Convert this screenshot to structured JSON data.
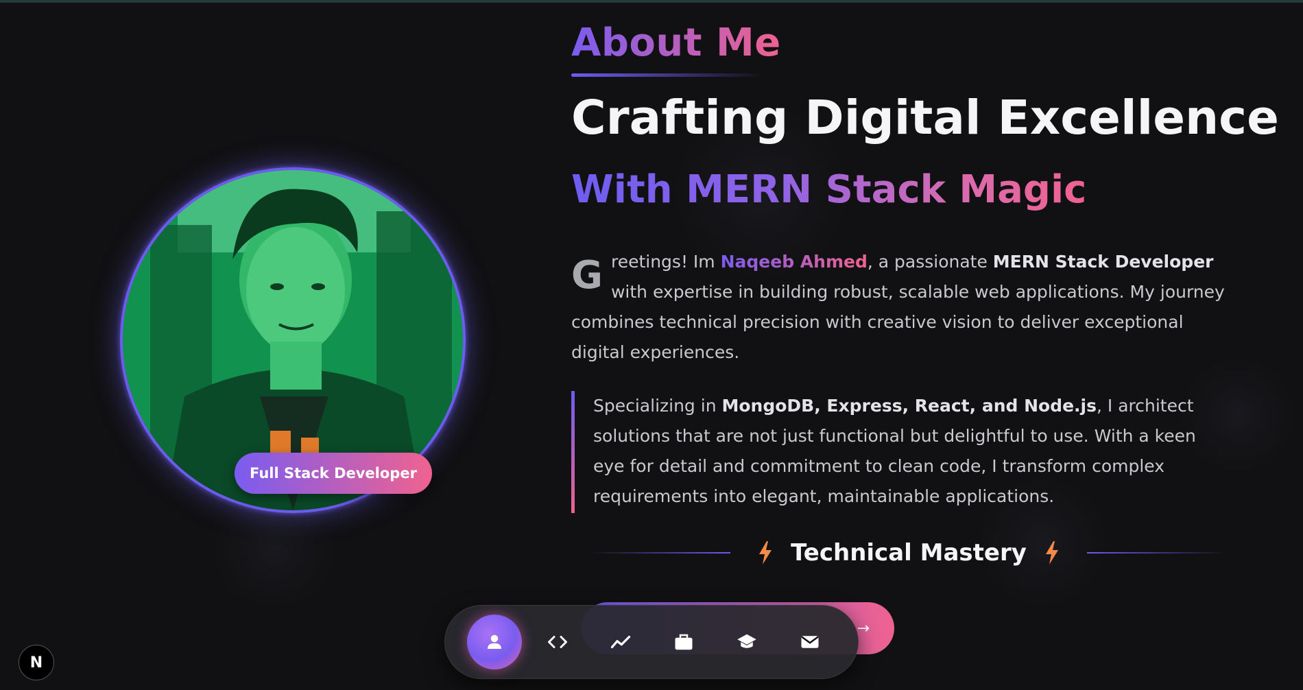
{
  "about": {
    "section_label": "About Me",
    "headline": "Crafting Digital Excellence",
    "subheadline": "With MERN Stack Magic",
    "intro": {
      "dropcap": "G",
      "part1": "reetings! Im ",
      "name": "Naqeeb Ahmed",
      "part2": ", a passionate ",
      "role": "MERN Stack Developer",
      "part3": " with expertise in building robust, scalable web applications. My journey combines technical precision with creative vision to deliver exceptional digital experiences."
    },
    "quote": {
      "part1": "Specializing in ",
      "stack": "MongoDB, Express, React, and Node.js",
      "part2": ", I architect solutions that are not just functional but delightful to use. With a keen eye for detail and commitment to clean code, I transform complex requirements into elegant, maintainable applications."
    },
    "tech_title": "Technical Mastery",
    "cta_arrow": "→"
  },
  "profile": {
    "role_badge": "Full Stack Developer"
  },
  "dock": {
    "items": [
      {
        "icon": "person-icon",
        "active": true
      },
      {
        "icon": "code-icon",
        "active": false
      },
      {
        "icon": "chart-line-icon",
        "active": false
      },
      {
        "icon": "briefcase-icon",
        "active": false
      },
      {
        "icon": "graduation-cap-icon",
        "active": false
      },
      {
        "icon": "envelope-icon",
        "active": false
      }
    ]
  },
  "corner_badge": {
    "label": "N"
  },
  "colors": {
    "accent_start": "#7a5cf0",
    "accent_end": "#f0628f",
    "background": "#111113",
    "bolt": "#f5894a"
  }
}
